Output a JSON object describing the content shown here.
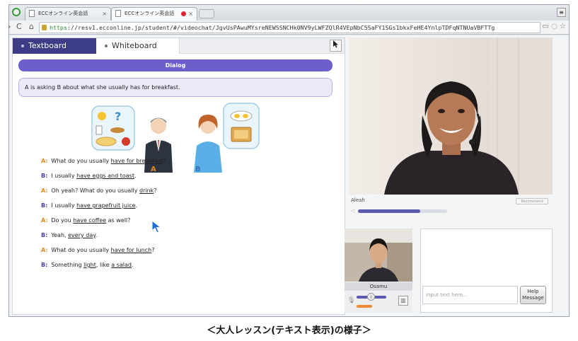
{
  "browser": {
    "tabs": [
      {
        "title": "ECCオンライン英会話"
      },
      {
        "title": "ECCオンライン英会話"
      }
    ],
    "url_scheme": "https",
    "url_rest": "://resv1.ecconline.jp/student/#/videochat/JgvUsPAwuMYsreNEWSSNCHk0NV9yLWFZQlR4VEpNbC5SaFY1SGs1bkxFeHE4YnlpTDFqNTNUaVBFTTg"
  },
  "textboard": {
    "tab_text": "Textboard",
    "tab_white": "Whiteboard",
    "dialog_title": "Dialog",
    "situation": "A is asking B about what she usually has for breakfast.",
    "label_a": "A",
    "label_b": "B",
    "lines": [
      {
        "speaker": "A",
        "pre": "What do you usually ",
        "u": "have for breakfast",
        "post": "?"
      },
      {
        "speaker": "B",
        "pre": "I usually ",
        "u": "have eggs and toast",
        "post": "."
      },
      {
        "speaker": "A",
        "pre": "Oh yeah? What do you usually ",
        "u": "drink",
        "post": "?"
      },
      {
        "speaker": "B",
        "pre": "I usually ",
        "u": "have grapefruit juice",
        "post": "."
      },
      {
        "speaker": "A",
        "pre": "Do you ",
        "u": "have coffee",
        "post": " as well?"
      },
      {
        "speaker": "B",
        "pre": "Yeah, ",
        "u": "every day",
        "post": "."
      },
      {
        "speaker": "A",
        "pre": "What do you usually ",
        "u": "have for lunch",
        "post": "?"
      },
      {
        "speaker": "B",
        "pre": "Something ",
        "u": "light",
        "post": ", like ",
        "u2": "a salad",
        "post2": "."
      }
    ]
  },
  "video": {
    "teacher_name": "Aleah",
    "recommend_label": "Recommend",
    "teacher_volume": 0.7,
    "self_name": "Osamu"
  },
  "chat": {
    "placeholder": "input text here...",
    "send_label_1": "Help",
    "send_label_2": "Message"
  },
  "caption": "＜大人レッスン(テキスト表示)の様子＞",
  "colors": {
    "accent": "#3d3c86",
    "dialog": "#6c5fcd",
    "speaker_a": "#e08a1e",
    "speaker_b": "#4a3fa8"
  }
}
